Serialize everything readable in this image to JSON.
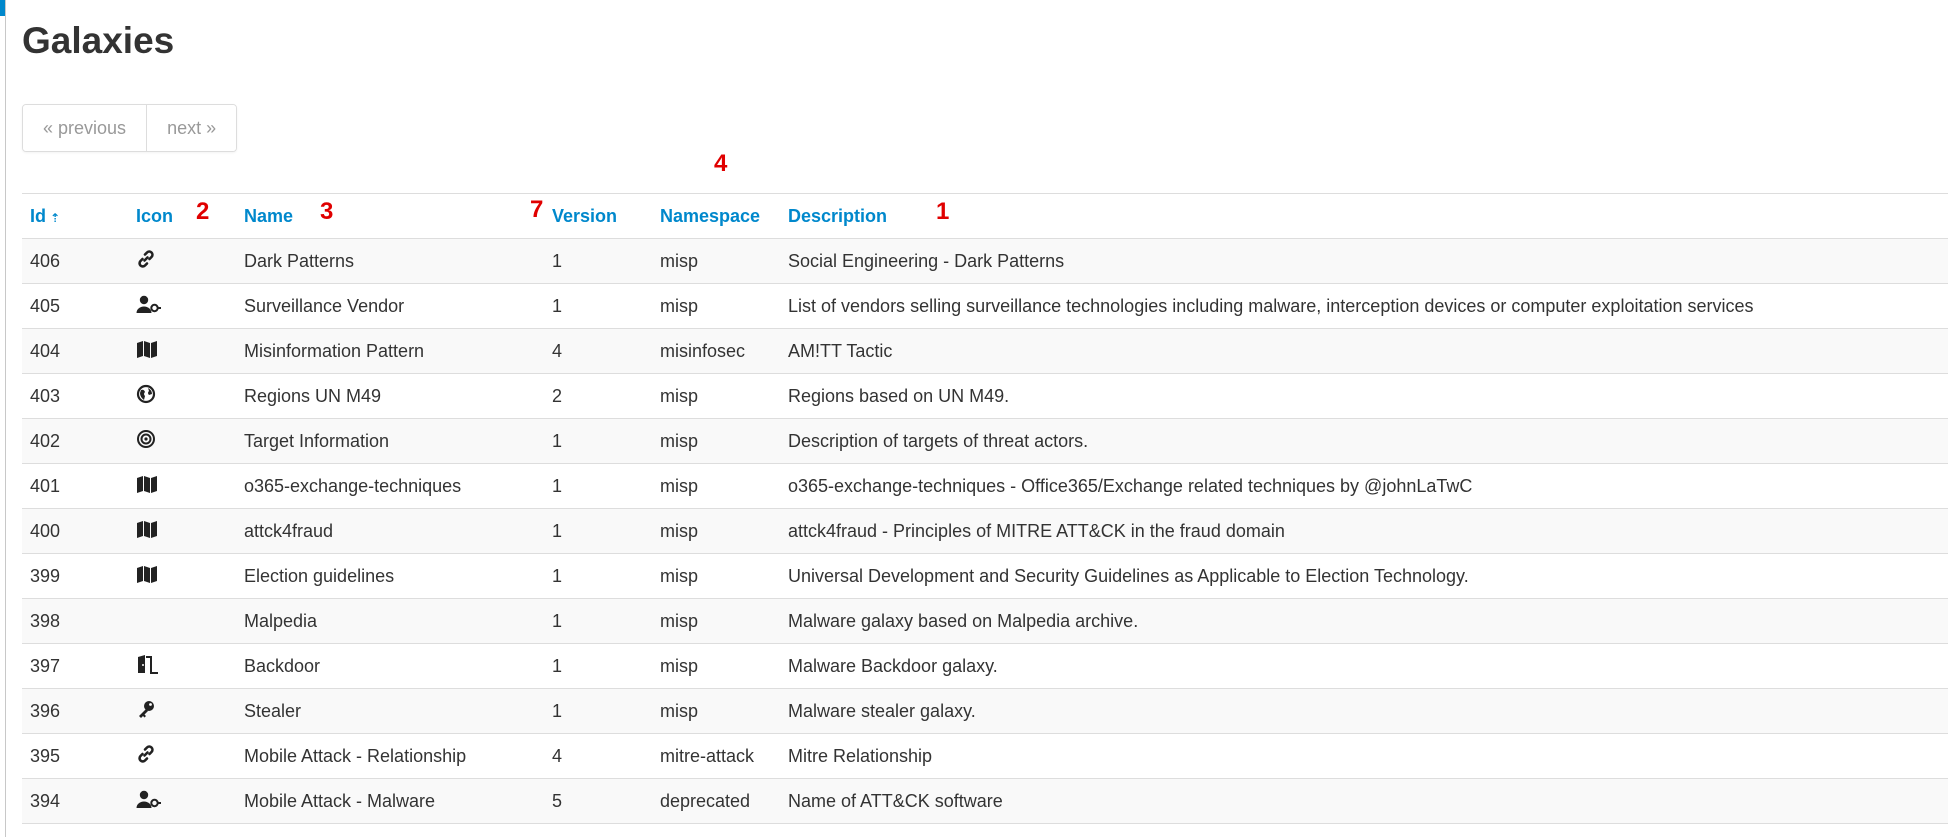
{
  "page": {
    "title": "Galaxies"
  },
  "pagination": {
    "previous_label": "« previous",
    "next_label": "next »"
  },
  "annotations": {
    "a1": "1",
    "a2": "2",
    "a3": "3",
    "a4": "4",
    "a7": "7"
  },
  "table": {
    "columns": {
      "id": "Id",
      "id_sort_indicator": "⇡",
      "icon": "Icon",
      "name": "Name",
      "version": "Version",
      "namespace": "Namespace",
      "description": "Description"
    },
    "rows": [
      {
        "id": "406",
        "icon": "link-icon",
        "name": "Dark Patterns",
        "version": "1",
        "namespace": "misp",
        "description": "Social Engineering - Dark Patterns"
      },
      {
        "id": "405",
        "icon": "user-secret-icon",
        "name": "Surveillance Vendor",
        "version": "1",
        "namespace": "misp",
        "description": "List of vendors selling surveillance technologies including malware, interception devices or computer exploitation services"
      },
      {
        "id": "404",
        "icon": "map-icon",
        "name": "Misinformation Pattern",
        "version": "4",
        "namespace": "misinfosec",
        "description": "AM!TT Tactic"
      },
      {
        "id": "403",
        "icon": "globe-icon",
        "name": "Regions UN M49",
        "version": "2",
        "namespace": "misp",
        "description": "Regions based on UN M49."
      },
      {
        "id": "402",
        "icon": "bullseye-icon",
        "name": "Target Information",
        "version": "1",
        "namespace": "misp",
        "description": "Description of targets of threat actors."
      },
      {
        "id": "401",
        "icon": "map-icon",
        "name": "o365-exchange-techniques",
        "version": "1",
        "namespace": "misp",
        "description": "o365-exchange-techniques - Office365/Exchange related techniques by @johnLaTwC"
      },
      {
        "id": "400",
        "icon": "map-icon",
        "name": "attck4fraud",
        "version": "1",
        "namespace": "misp",
        "description": "attck4fraud - Principles of MITRE ATT&CK in the fraud domain"
      },
      {
        "id": "399",
        "icon": "map-icon",
        "name": "Election guidelines",
        "version": "1",
        "namespace": "misp",
        "description": "Universal Development and Security Guidelines as Applicable to Election Technology."
      },
      {
        "id": "398",
        "icon": "",
        "name": "Malpedia",
        "version": "1",
        "namespace": "misp",
        "description": "Malware galaxy based on Malpedia archive."
      },
      {
        "id": "397",
        "icon": "door-open-icon",
        "name": "Backdoor",
        "version": "1",
        "namespace": "misp",
        "description": "Malware Backdoor galaxy."
      },
      {
        "id": "396",
        "icon": "key-icon",
        "name": "Stealer",
        "version": "1",
        "namespace": "misp",
        "description": "Malware stealer galaxy."
      },
      {
        "id": "395",
        "icon": "link-icon",
        "name": "Mobile Attack - Relationship",
        "version": "4",
        "namespace": "mitre-attack",
        "description": "Mitre Relationship"
      },
      {
        "id": "394",
        "icon": "user-secret-icon",
        "name": "Mobile Attack - Malware",
        "version": "5",
        "namespace": "deprecated",
        "description": "Name of ATT&CK software"
      }
    ]
  }
}
